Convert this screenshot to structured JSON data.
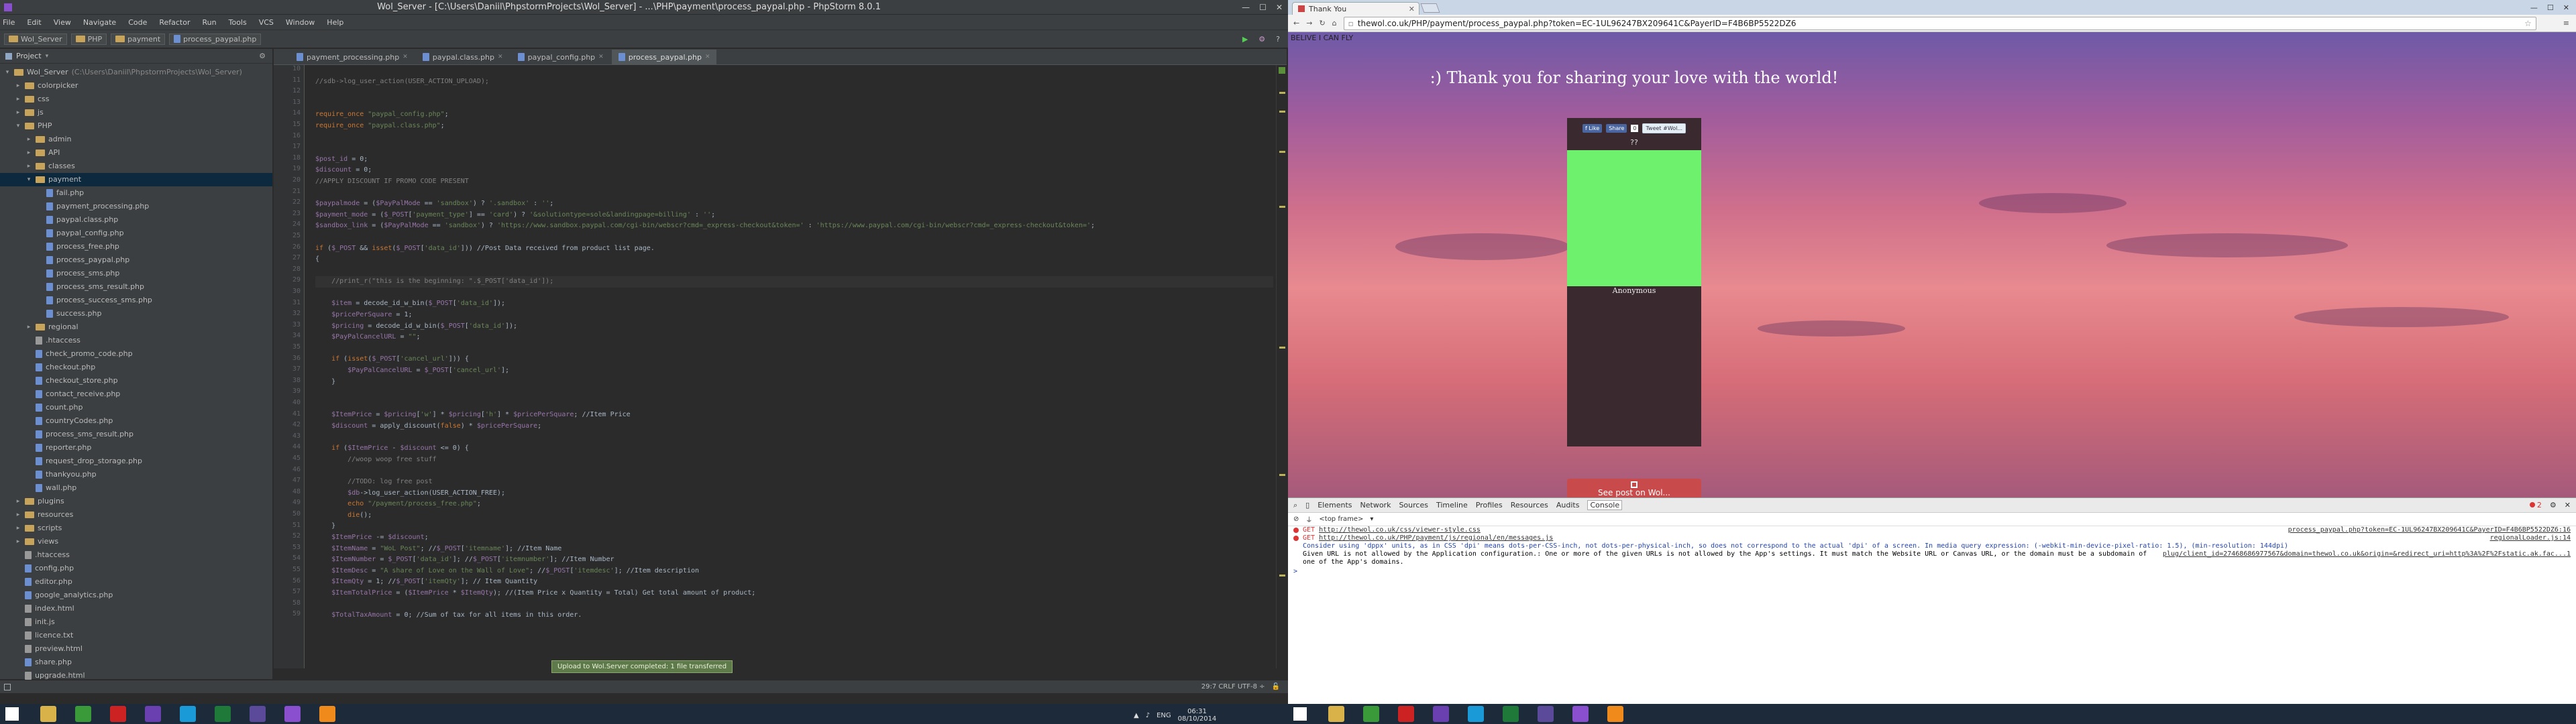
{
  "ide": {
    "title": "Wol_Server - [C:\\Users\\Daniil\\PhpstormProjects\\Wol_Server] - ...\\PHP\\payment\\process_paypal.php - PhpStorm 8.0.1",
    "menu": [
      "File",
      "Edit",
      "View",
      "Navigate",
      "Code",
      "Refactor",
      "Run",
      "Tools",
      "VCS",
      "Window",
      "Help"
    ],
    "breadcrumbs": [
      "Wol_Server",
      "PHP",
      "payment",
      "process_paypal.php"
    ],
    "project_label": "Project",
    "tree": [
      {
        "label": "Wol_Server",
        "note": "(C:\\Users\\Daniil\\PhpstormProjects\\Wol_Server)",
        "type": "folder",
        "level": 0,
        "arrow": "▾"
      },
      {
        "label": "colorpicker",
        "type": "folder",
        "level": 1,
        "arrow": "▸"
      },
      {
        "label": "css",
        "type": "folder",
        "level": 1,
        "arrow": "▸"
      },
      {
        "label": "js",
        "type": "folder",
        "level": 1,
        "arrow": "▸"
      },
      {
        "label": "PHP",
        "type": "folder",
        "level": 1,
        "arrow": "▾"
      },
      {
        "label": "admin",
        "type": "folder",
        "level": 2,
        "arrow": "▸"
      },
      {
        "label": "API",
        "type": "folder",
        "level": 2,
        "arrow": "▸"
      },
      {
        "label": "classes",
        "type": "folder",
        "level": 2,
        "arrow": "▸"
      },
      {
        "label": "payment",
        "type": "folder",
        "level": 2,
        "arrow": "▾",
        "selected": true
      },
      {
        "label": "fail.php",
        "type": "php",
        "level": 3
      },
      {
        "label": "payment_processing.php",
        "type": "php",
        "level": 3
      },
      {
        "label": "paypal.class.php",
        "type": "php",
        "level": 3
      },
      {
        "label": "paypal_config.php",
        "type": "php",
        "level": 3
      },
      {
        "label": "process_free.php",
        "type": "php",
        "level": 3
      },
      {
        "label": "process_paypal.php",
        "type": "php",
        "level": 3
      },
      {
        "label": "process_sms.php",
        "type": "php",
        "level": 3
      },
      {
        "label": "process_sms_result.php",
        "type": "php",
        "level": 3
      },
      {
        "label": "process_success_sms.php",
        "type": "php",
        "level": 3
      },
      {
        "label": "success.php",
        "type": "php",
        "level": 3
      },
      {
        "label": "regional",
        "type": "folder",
        "level": 2,
        "arrow": "▸"
      },
      {
        "label": ".htaccess",
        "type": "gen",
        "level": 2
      },
      {
        "label": "check_promo_code.php",
        "type": "php",
        "level": 2
      },
      {
        "label": "checkout.php",
        "type": "php",
        "level": 2
      },
      {
        "label": "checkout_store.php",
        "type": "php",
        "level": 2
      },
      {
        "label": "contact_receive.php",
        "type": "php",
        "level": 2
      },
      {
        "label": "count.php",
        "type": "php",
        "level": 2
      },
      {
        "label": "countryCodes.php",
        "type": "php",
        "level": 2
      },
      {
        "label": "process_sms_result.php",
        "type": "php",
        "level": 2
      },
      {
        "label": "reporter.php",
        "type": "php",
        "level": 2
      },
      {
        "label": "request_drop_storage.php",
        "type": "php",
        "level": 2
      },
      {
        "label": "thankyou.php",
        "type": "php",
        "level": 2
      },
      {
        "label": "wall.php",
        "type": "php",
        "level": 2
      },
      {
        "label": "plugins",
        "type": "folder",
        "level": 1,
        "arrow": "▸"
      },
      {
        "label": "resources",
        "type": "folder",
        "level": 1,
        "arrow": "▸"
      },
      {
        "label": "scripts",
        "type": "folder",
        "level": 1,
        "arrow": "▸"
      },
      {
        "label": "views",
        "type": "folder",
        "level": 1,
        "arrow": "▸"
      },
      {
        "label": ".htaccess",
        "type": "gen",
        "level": 1
      },
      {
        "label": "config.php",
        "type": "php",
        "level": 1
      },
      {
        "label": "editor.php",
        "type": "php",
        "level": 1
      },
      {
        "label": "google_analytics.php",
        "type": "php",
        "level": 1
      },
      {
        "label": "index.html",
        "type": "gen",
        "level": 1
      },
      {
        "label": "init.js",
        "type": "gen",
        "level": 1
      },
      {
        "label": "licence.txt",
        "type": "gen",
        "level": 1
      },
      {
        "label": "preview.html",
        "type": "gen",
        "level": 1
      },
      {
        "label": "share.php",
        "type": "php",
        "level": 1
      },
      {
        "label": "upgrade.html",
        "type": "gen",
        "level": 1
      }
    ],
    "tabs": [
      {
        "label": "payment_processing.php",
        "active": false
      },
      {
        "label": "paypal.class.php",
        "active": false
      },
      {
        "label": "paypal_config.php",
        "active": false
      },
      {
        "label": "process_paypal.php",
        "active": true
      }
    ],
    "line_start": 10,
    "code_lines": [
      "",
      "//sdb->log_user_action(USER_ACTION_UPLOAD);",
      "",
      "",
      "require_once \"paypal_config.php\";",
      "require_once \"paypal.class.php\";",
      "",
      "",
      "$post_id = 0;",
      "$discount = 0;",
      "//APPLY DISCOUNT IF PROMO CODE PRESENT",
      "",
      "$paypalmode = ($PayPalMode == 'sandbox') ? '.sandbox' : '';",
      "$payment_mode = ($_POST['payment_type'] == 'card') ? '&solutiontype=sole&landingpage=billing' : '';",
      "$sandbox_link = ($PayPalMode == 'sandbox') ? 'https://www.sandbox.paypal.com/cgi-bin/webscr?cmd=_express-checkout&token=' : 'https://www.paypal.com/cgi-bin/webscr?cmd=_express-checkout&token=';",
      "",
      "if ($_POST && isset($_POST['data_id'])) //Post Data received from product list page.",
      "{",
      "",
      "    //print_r(\"this is the beginning: \".$_POST['data_id']);",
      "",
      "    $item = decode_id_w_bin($_POST['data_id']);",
      "    $pricePerSquare = 1;",
      "    $pricing = decode_id_w_bin($_POST['data_id']);",
      "    $PayPalCancelURL = \"\";",
      "",
      "    if (isset($_POST['cancel_url'])) {",
      "        $PayPalCancelURL = $_POST['cancel_url'];",
      "    }",
      "",
      "",
      "    $ItemPrice = $pricing['w'] * $pricing['h'] * $pricePerSquare; //Item Price",
      "    $discount = apply_discount(false) * $pricePerSquare;",
      "",
      "    if ($ItemPrice - $discount <= 0) {",
      "        //woop woop free stuff",
      "",
      "        //TODO: log free post",
      "        $db->log_user_action(USER_ACTION_FREE);",
      "        echo \"/payment/process_free.php\";",
      "        die();",
      "    }",
      "    $ItemPrice -= $discount;",
      "    $ItemName = \"WoL Post\"; //$_POST['itemname']; //Item Name",
      "    $ItemNumber = $_POST['data_id']; //$_POST['itemnumber']; //Item Number",
      "    $ItemDesc = \"A share of Love on the Wall of Love\"; //$_POST['itemdesc']; //Item description",
      "    $ItemQty = 1; //$_POST['itemQty']; // Item Quantity",
      "    $ItemTotalPrice = ($ItemPrice * $ItemQty); //(Item Price x Quantity = Total) Get total amount of product;",
      "",
      "    $TotalTaxAmount = 0; //Sum of tax for all items in this order."
    ],
    "status_right": "29:7   CRLF   UTF-8 ÷",
    "toast": "Upload to Wol.Server completed: 1 file transferred"
  },
  "browser": {
    "tab_title": "Thank You",
    "url": "thewol.co.uk/PHP/payment/process_paypal.php?token=EC-1UL96247BX209641C&PayerID=F4B6BP5522DZ6",
    "page": {
      "top_label": "BELIVE I CAN FLY",
      "heading": ":) Thank you for sharing your love with the world!",
      "like_label": "Like",
      "share_label": "Share",
      "share_count": "0",
      "tweet_label": "Tweet #Wol...",
      "question": "??",
      "author": "Anonymous",
      "see_post": "See post on Wol..."
    },
    "devtools": {
      "tabs": [
        "Elements",
        "Network",
        "Sources",
        "Timeline",
        "Profiles",
        "Resources",
        "Audits",
        "Console"
      ],
      "active_tab": "Console",
      "frame": "<top frame>",
      "errors": 2,
      "lines": [
        {
          "kind": "err",
          "text": "GET",
          "link": "http://thewol.co.uk/css/viewer-style.css",
          "src": "process_paypal.php?token=EC-1UL96247BX209641C&PayerID=F4B6BP5522DZ6:16"
        },
        {
          "kind": "err",
          "text": "GET",
          "link": "http://thewol.co.uk/PHP/payment/js/regional/en/messages.js",
          "src": "regionalLoader.js:14"
        },
        {
          "kind": "info",
          "text": "Consider using 'dppx' units, as in CSS 'dpi' means dots-per-CSS-inch, not dots-per-physical-inch, so does not correspond to the actual 'dpi' of a screen. In media query expression: (-webkit-min-device-pixel-ratio: 1.5), (min-resolution: 144dpi)",
          "src": ""
        },
        {
          "kind": "plain",
          "text": "Given URL is not allowed by the Application configuration.: One or more of the given URLs is not allowed by the App's settings.  It must match the Website URL or Canvas URL, or the domain must be a subdomain of one of the App's domains.",
          "src": "plug/client_id=27468686977567&domain=thewol.co.uk&origin=&redirect_uri=http%3A%2F%2Fstatic.ak.fac...1"
        }
      ],
      "prompt": ">"
    }
  },
  "taskbar": {
    "time": "06:31",
    "date": "08/10/2014",
    "lang": "ENG",
    "icons": [
      "start-button",
      "explorer-icon",
      "chrome-icon",
      "opera-icon",
      "visual-studio-icon",
      "skype-icon",
      "excel-icon",
      "media-icon",
      "phpstorm-icon",
      "vlc-icon"
    ]
  }
}
